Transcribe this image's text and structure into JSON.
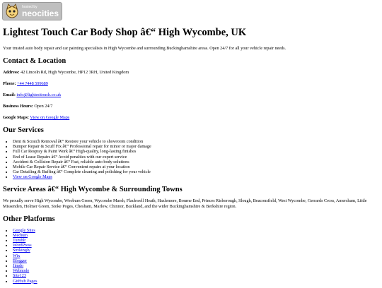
{
  "badge": {
    "small": "hosted by",
    "big": "neocities"
  },
  "title": "Lightest Touch Car Body Shop â€“ High Wycombe, UK",
  "intro": "Your trusted auto body repair and car painting specialists in High Wycombe and surrounding Buckinghamshire areas. Open 24/7 for all your vehicle repair needs.",
  "contact": {
    "heading": "Contact & Location",
    "address_label": "Address:",
    "address_value": "42 Lincoln Rd, High Wycombe, HP12 3RH, United Kingdom",
    "phone_label": "Phone:",
    "phone_value": "+44 7448 599689",
    "email_label": "Email:",
    "email_value": "info@lightesttouch.co.uk",
    "hours_label": "Business Hours:",
    "hours_value": "Open 24/7",
    "maps_label": "Google Maps:",
    "maps_link": "View on Google Maps"
  },
  "services": {
    "heading": "Our Services",
    "items": [
      "Dent & Scratch Removal â€“ Restore your vehicle to showroom condition",
      "Bumper Repair & Scuff Fix â€“ Professional repair for minor or major damage",
      "Full Car Respray & Paint Work â€“ High-quality, long-lasting finishes",
      "End of Lease Repairs â€“ Avoid penalties with our expert service",
      "Accident & Collision Repair â€“ Fast, reliable auto body solutions",
      "Mobile Car Repair Service â€“ Convenient repairs at your location",
      "Car Detailing & Buffing â€“ Complete cleaning and polishing for your vehicle"
    ],
    "maps_link": "View on Google Maps"
  },
  "areas": {
    "heading": "Service Areas â€“ High Wycombe & Surrounding Towns",
    "text": "We proudly serve High Wycombe, Wooburn Green, Wycombe Marsh, Flackwell Heath, Hazlemere, Bourne End, Princes Risborough, Slough, Beaconsfield, West Wycombe, Gerrards Cross, Amersham, Little Missenden, Holmer Green, Stoke Poges, Chesham, Marlow, Chinnor, Buckland, and the wider Buckinghamshire & Berkshire region."
  },
  "platforms": {
    "heading": "Other Platforms",
    "items": [
      "Google Sites",
      "Medium",
      "Tumblr",
      "WordPress",
      "Strikingly",
      "Wix",
      "Blogger",
      "Jimdo",
      "Webnode",
      "Site123",
      "GitHub Pages"
    ]
  }
}
